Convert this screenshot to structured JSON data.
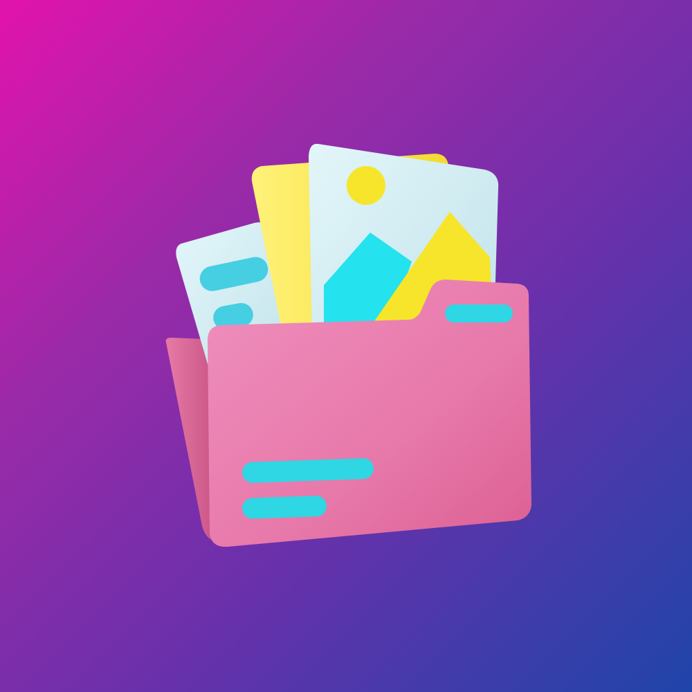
{
  "scene": {
    "subject": "folder-with-photos-icon",
    "colors": {
      "background_start": "#e213ad",
      "background_mid": "#6a30ab",
      "background_end": "#1f45aa",
      "folder": "#e97fb0",
      "folder_back": "#d9608f",
      "accent_cyan": "#2fd6e4",
      "photo_card": "#cfeef3",
      "yellow_card": "#f7e33a",
      "sun": "#f6e52a",
      "mountain_cyan": "#24e2ee",
      "mountain_yellow": "#f6e52a"
    }
  }
}
